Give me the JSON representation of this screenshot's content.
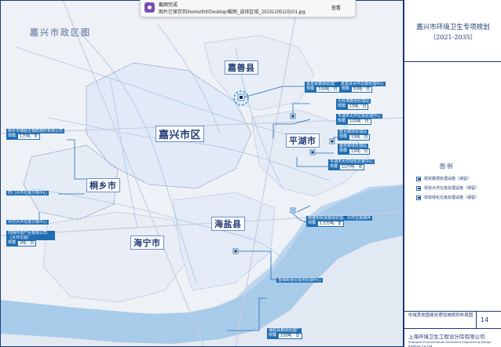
{
  "map_title": "嘉兴市政区图",
  "notification": {
    "title": "截图完成",
    "message": "图片已保存到/home/thtf/Desktop/截图_选择区域_20231205115101.jpg",
    "button": "查看"
  },
  "sidebar": {
    "title": "嘉兴市环境卫生专项规划",
    "years": "（2021-2035）",
    "legend_title": "图  例",
    "legend_items": [
      "现状粪便处理设施（保留）",
      "现状大件垃圾处理设施（保留）",
      "现状绿化垃圾处理设施（保留）"
    ],
    "footer_title": "市域其他固废处理设施规划布局图",
    "page_number": "14",
    "company": "上海环境卫生工程设计院有限公司",
    "company_en": "Shanghai Environmental Sanitation Engineering Design Institute Co.,Ltd"
  },
  "regions": {
    "jiaxing": "嘉兴市区",
    "jiashan": "嘉善县",
    "pinghu": "平湖市",
    "tongxiang": "桐乡市",
    "haiyan": "海盐县",
    "haining": "海宁市"
  },
  "facilities": {
    "jiashan_fecal": {
      "name": "嘉善县粪便处理厂",
      "scale_label": "规模",
      "scale": "100吨／日"
    },
    "jiashan_bulky": {
      "name": "嘉善县大件垃圾处理中心",
      "scale_label": "规模",
      "scale": "50吨／日"
    },
    "pinghu_fecal_1": {
      "name": "大昇港粪便处理站",
      "scale_label": "规模",
      "scale": "15吨／日"
    },
    "pinghu_bulky": {
      "name": "平湖市大件垃圾处理中心",
      "scale_label": "规模",
      "scale": "100吨／日"
    },
    "pinghu_fecal_2": {
      "name": "胜合粪便处理站",
      "scale_label": "规模",
      "scale": "15吨／日"
    },
    "pinghu_fecal_3": {
      "name": "金桥粪便处理站",
      "scale_label": "规模",
      "scale": "15吨／日"
    },
    "pinghu_greening": {
      "name": "平湖市大件绿化处置中心",
      "scale_label": "规模",
      "scale": "10万吨／年"
    },
    "tongxiang_bio": {
      "name": "桐乡市博能生物质燃料有限公司",
      "scale_label": "规模",
      "scale": "1万吨／年"
    },
    "tongxiang_bulky": {
      "name": "石门大件垃圾分拣中心"
    },
    "haining_sorting": {
      "name": "许村大件垃圾分拣中心"
    },
    "haining_env": {
      "name": "鸿翔环境产业有限公司（大件垃圾）",
      "scale_label": "规模",
      "scale": "3吨／日"
    },
    "haiyan_xitang": {
      "name": "西塘桥街道粪便处理、大件垃圾破碎",
      "scale_label": "规模",
      "scale": "1.5万吨／年"
    },
    "haiyan_wangbian": {
      "name": "望海街道垃圾预处理中心"
    },
    "haiyan_fecal": {
      "name": "海盐县粪便处理厂",
      "scale_label": "规模",
      "scale": "100吨／日"
    }
  }
}
